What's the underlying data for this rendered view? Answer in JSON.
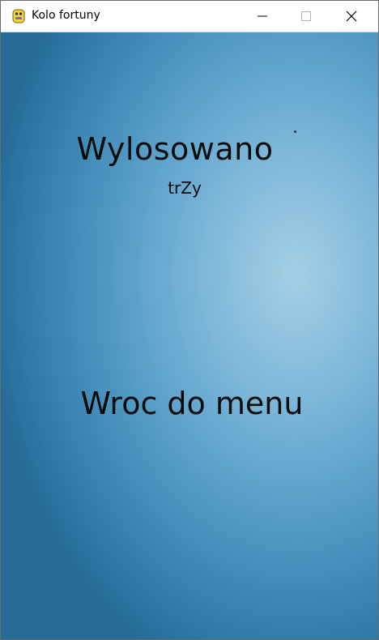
{
  "window": {
    "title": "Kolo fortuny",
    "app_icon": "python-icon",
    "controls": [
      "minimize-icon",
      "maximize-icon",
      "close-icon"
    ]
  },
  "screen": {
    "heading": "Wylosowano",
    "result": "trZy",
    "menu_button_label": "Wroc do menu"
  },
  "colors": {
    "background_light": "#a5cfe6",
    "background_dark": "#266c98",
    "text": "#0b0b0b"
  }
}
